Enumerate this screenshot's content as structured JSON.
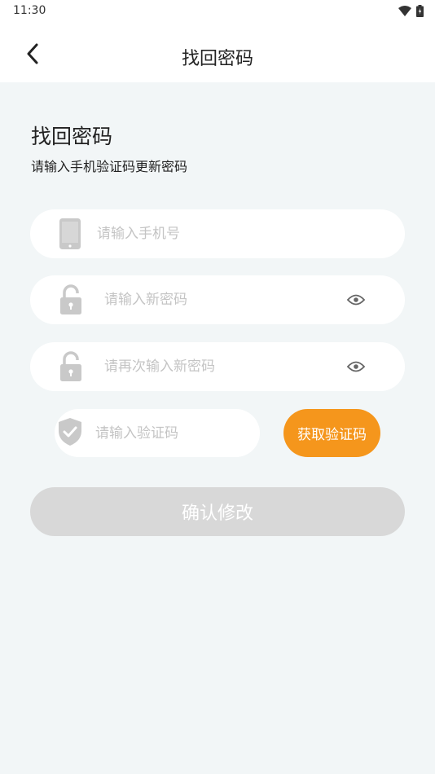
{
  "status_bar": {
    "time": "11:30"
  },
  "header": {
    "title": "找回密码"
  },
  "intro": {
    "heading": "找回密码",
    "subtitle": "请输入手机验证码更新密码"
  },
  "form": {
    "phone": {
      "placeholder": "请输入手机号",
      "icon": "phone-icon"
    },
    "new_password": {
      "placeholder": "请输入新密码",
      "icon": "lock-icon"
    },
    "confirm_password": {
      "placeholder": "请再次输入新密码",
      "icon": "lock-icon"
    },
    "code": {
      "placeholder": "请输入验证码",
      "icon": "shield-check-icon"
    },
    "get_code_label": "获取验证码",
    "submit_label": "确认修改"
  },
  "colors": {
    "accent": "#f5961c",
    "background": "#f2f6f7",
    "disabled_button": "#d8d8d8",
    "icon_gray": "#c9c9c9"
  }
}
